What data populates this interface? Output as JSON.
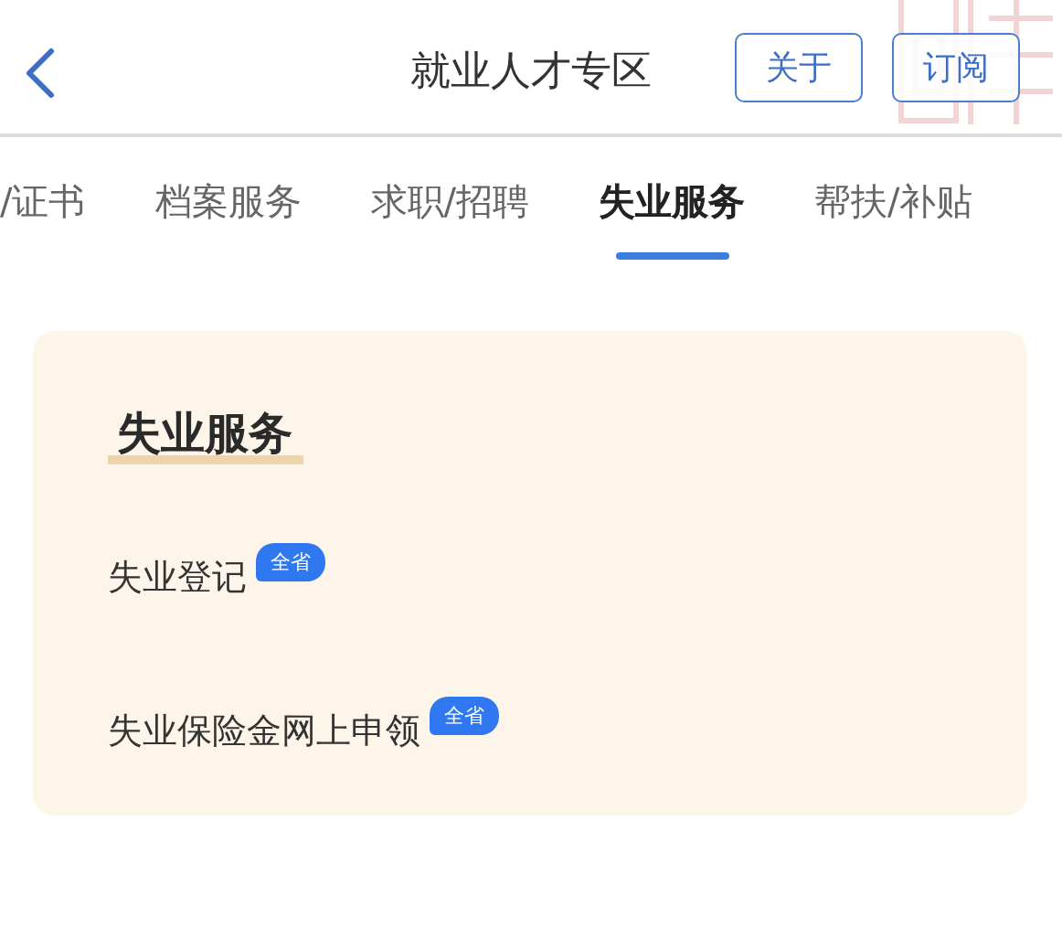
{
  "header": {
    "title": "就业人才专区",
    "buttons": [
      "关于",
      "订阅"
    ]
  },
  "tabs": [
    {
      "label": "/证书",
      "selected": false
    },
    {
      "label": "档案服务",
      "selected": false
    },
    {
      "label": "求职/招聘",
      "selected": false
    },
    {
      "label": "失业服务",
      "selected": true
    },
    {
      "label": "帮扶/补贴",
      "selected": false
    }
  ],
  "card": {
    "title": "失业服务",
    "items": [
      {
        "label": "失业登记",
        "badge": "全省"
      },
      {
        "label": "失业保险金网上申领",
        "badge": "全省"
      }
    ]
  }
}
